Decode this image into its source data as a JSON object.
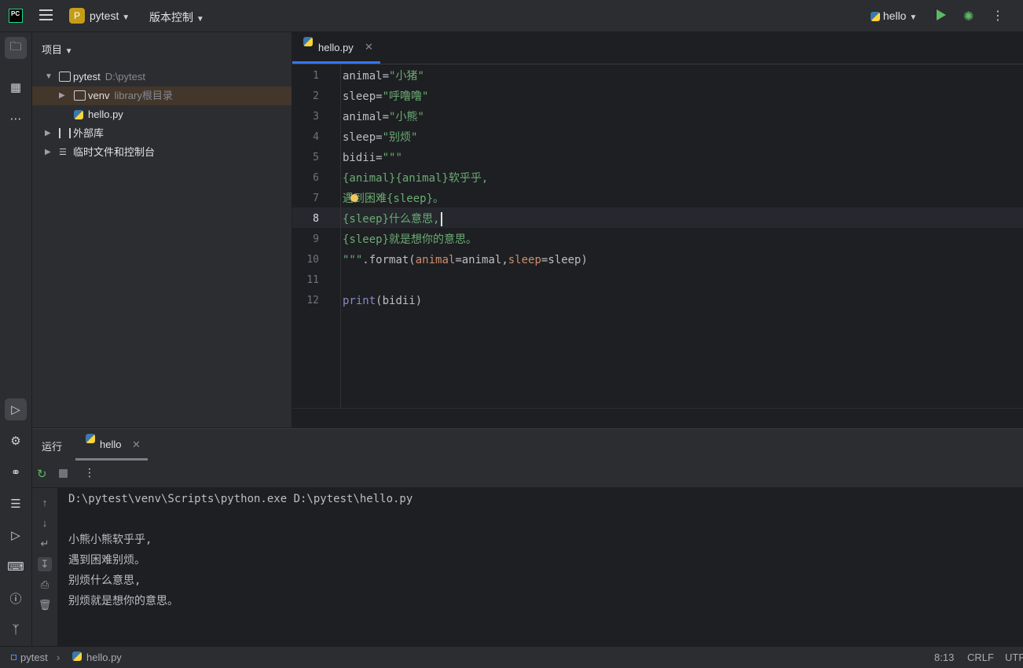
{
  "titlebar": {
    "logo": "PC",
    "project_badge": "P",
    "project_name": "pytest",
    "vcs_label": "版本控制",
    "run_config": "hello"
  },
  "project_panel": {
    "header": "项目",
    "tree": [
      {
        "label": "pytest",
        "hint": "D:\\pytest"
      },
      {
        "label": "venv",
        "hint": "library根目录"
      },
      {
        "label": "hello.py",
        "hint": ""
      },
      {
        "label": "外部库",
        "hint": ""
      },
      {
        "label": "临时文件和控制台",
        "hint": ""
      }
    ]
  },
  "editor": {
    "tab_label": "hello.py",
    "current_line": 8,
    "line_numbers": [
      "1",
      "2",
      "3",
      "4",
      "5",
      "6",
      "7",
      "8",
      "9",
      "10",
      "11",
      "12"
    ],
    "code": {
      "l1_name": "animal",
      "l1_eq": "=",
      "l1_str": "\"小猪\"",
      "l2_name": "sleep",
      "l2_eq": "=",
      "l2_str": "\"呼噜噜\"",
      "l3_name": "animal",
      "l3_eq": "=",
      "l3_str": "\"小熊\"",
      "l4_name": "sleep",
      "l4_eq": "=",
      "l4_str": "\"别烦\"",
      "l5_name": "bidii",
      "l5_eq": "=",
      "l5_str": "\"\"\"",
      "l6_str": "{animal}{animal}软乎乎,",
      "l7_str": "遇到困难{sleep}。",
      "l8_str": "{sleep}什么意思,",
      "l9_str": "{sleep}就是想你的意思。",
      "l10_str": "\"\"\"",
      "l10_method": ".format(",
      "l10_p1": "animal",
      "l10_eq1": "=animal,",
      "l10_p2": "sleep",
      "l10_eq2": "=sleep)",
      "l12_kw": "print",
      "l12_rest": "(bidii)"
    }
  },
  "run_panel": {
    "title": "运行",
    "tab_label": "hello",
    "console": [
      "D:\\pytest\\venv\\Scripts\\python.exe D:\\pytest\\hello.py",
      "",
      "小熊小熊软乎乎,",
      "遇到困难别烦。",
      "别烦什么意思,",
      "别烦就是想你的意思。"
    ]
  },
  "statusbar": {
    "crumb_project": "pytest",
    "crumb_file": "hello.py",
    "position": "8:13",
    "line_sep": "CRLF",
    "encoding": "UTF"
  }
}
